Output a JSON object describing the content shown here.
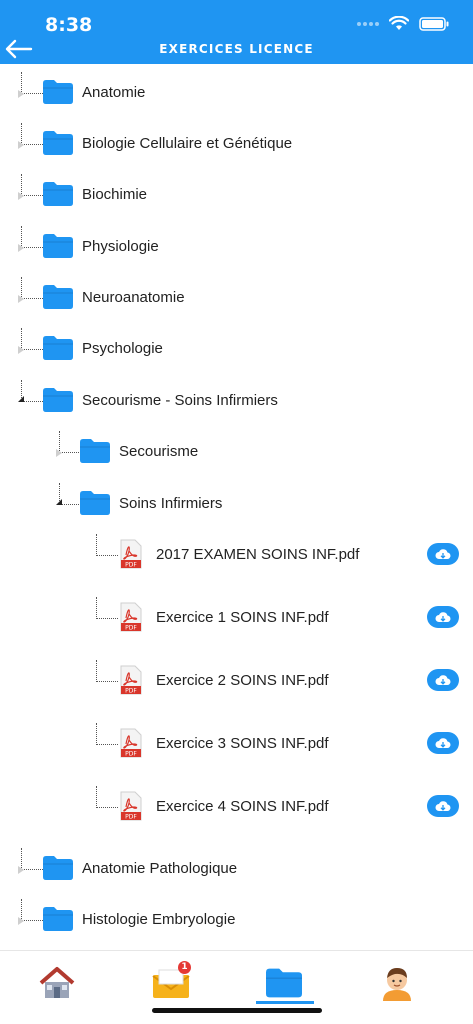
{
  "status": {
    "time": "8:38"
  },
  "header": {
    "title": "EXERCICES LICENCE"
  },
  "tree": {
    "folders_top": [
      {
        "label": "Anatomie"
      },
      {
        "label": "Biologie Cellulaire et Génétique"
      },
      {
        "label": "Biochimie"
      },
      {
        "label": "Physiologie"
      },
      {
        "label": "Neuroanatomie"
      },
      {
        "label": "Psychologie"
      }
    ],
    "expanded": {
      "label": "Secourisme - Soins Infirmiers",
      "children": [
        {
          "label": "Secourisme"
        },
        {
          "label": "Soins Infirmiers"
        }
      ],
      "files": [
        {
          "label": "2017 EXAMEN SOINS INF.pdf"
        },
        {
          "label": "Exercice 1 SOINS INF.pdf"
        },
        {
          "label": "Exercice 2 SOINS INF.pdf"
        },
        {
          "label": "Exercice 3 SOINS INF.pdf"
        },
        {
          "label": "Exercice 4 SOINS INF.pdf"
        }
      ]
    },
    "folders_bottom": [
      {
        "label": "Anatomie Pathologique"
      },
      {
        "label": "Histologie Embryologie"
      }
    ]
  },
  "pdf_icon_text": "PDF",
  "tabbar": {
    "mail_badge": "1",
    "active_tab": "folders"
  },
  "colors": {
    "accent": "#1f95f2",
    "pdf_red": "#d9362b",
    "badge": "#e53935"
  }
}
